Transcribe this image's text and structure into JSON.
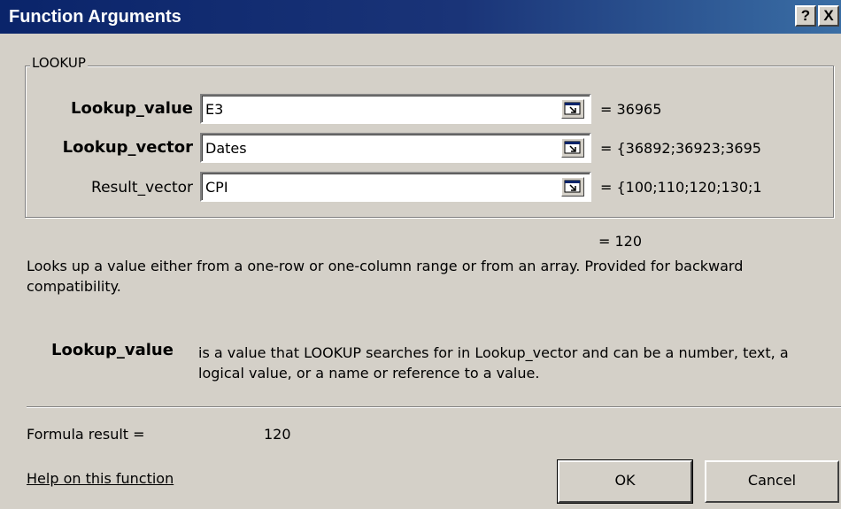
{
  "window": {
    "title": "Function Arguments",
    "help_label": "?",
    "close_label": "X"
  },
  "group": {
    "label": "LOOKUP"
  },
  "arguments": [
    {
      "name": "Lookup_value",
      "value": "E3",
      "evaluated": "= 36965",
      "bold": true
    },
    {
      "name": "Lookup_vector",
      "value": "Dates",
      "evaluated": "= {36892;36923;3695",
      "bold": true
    },
    {
      "name": "Result_vector",
      "value": "CPI",
      "evaluated": "= {100;110;120;130;1",
      "bold": false
    }
  ],
  "function_result": "= 120",
  "description": "Looks up a value either from a one-row or one-column range or from an array. Provided for backward compatibility.",
  "arg_help": {
    "name": "Lookup_value",
    "text": "is a value that LOOKUP searches for in Lookup_vector and can be a number, text, a logical value, or a name or reference to a value."
  },
  "formula": {
    "label": "Formula result =",
    "value": "120"
  },
  "help_link": "Help on this function",
  "buttons": {
    "ok": "OK",
    "cancel": "Cancel"
  },
  "colors": {
    "titlebar": "#0a246a",
    "dialog_bg": "#d4d0c8"
  }
}
